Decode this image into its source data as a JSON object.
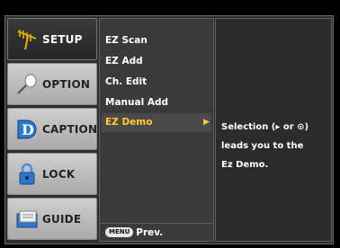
{
  "sidebar": {
    "items": [
      {
        "label": "SETUP",
        "icon": "antenna-icon",
        "active": true
      },
      {
        "label": "OPTION",
        "icon": "pen-icon",
        "active": false
      },
      {
        "label": "CAPTION",
        "icon": "caption-d-icon",
        "active": false
      },
      {
        "label": "LOCK",
        "icon": "padlock-icon",
        "active": false
      },
      {
        "label": "GUIDE",
        "icon": "guide-book-icon",
        "active": false
      }
    ]
  },
  "menu": {
    "items": [
      {
        "label": "EZ Scan"
      },
      {
        "label": "EZ Add"
      },
      {
        "label": "Ch. Edit"
      },
      {
        "label": "Manual Add"
      },
      {
        "label": "EZ Demo",
        "selected": true
      }
    ],
    "footer": {
      "button": "MENU",
      "label": "Prev."
    }
  },
  "info": {
    "lines": [
      "Selection (▸ or ⊙)",
      "leads you to the",
      "Ez Demo."
    ]
  },
  "colors": {
    "selected_text": "#ffcc33",
    "active_tab_bg": "#2f2f2f"
  }
}
